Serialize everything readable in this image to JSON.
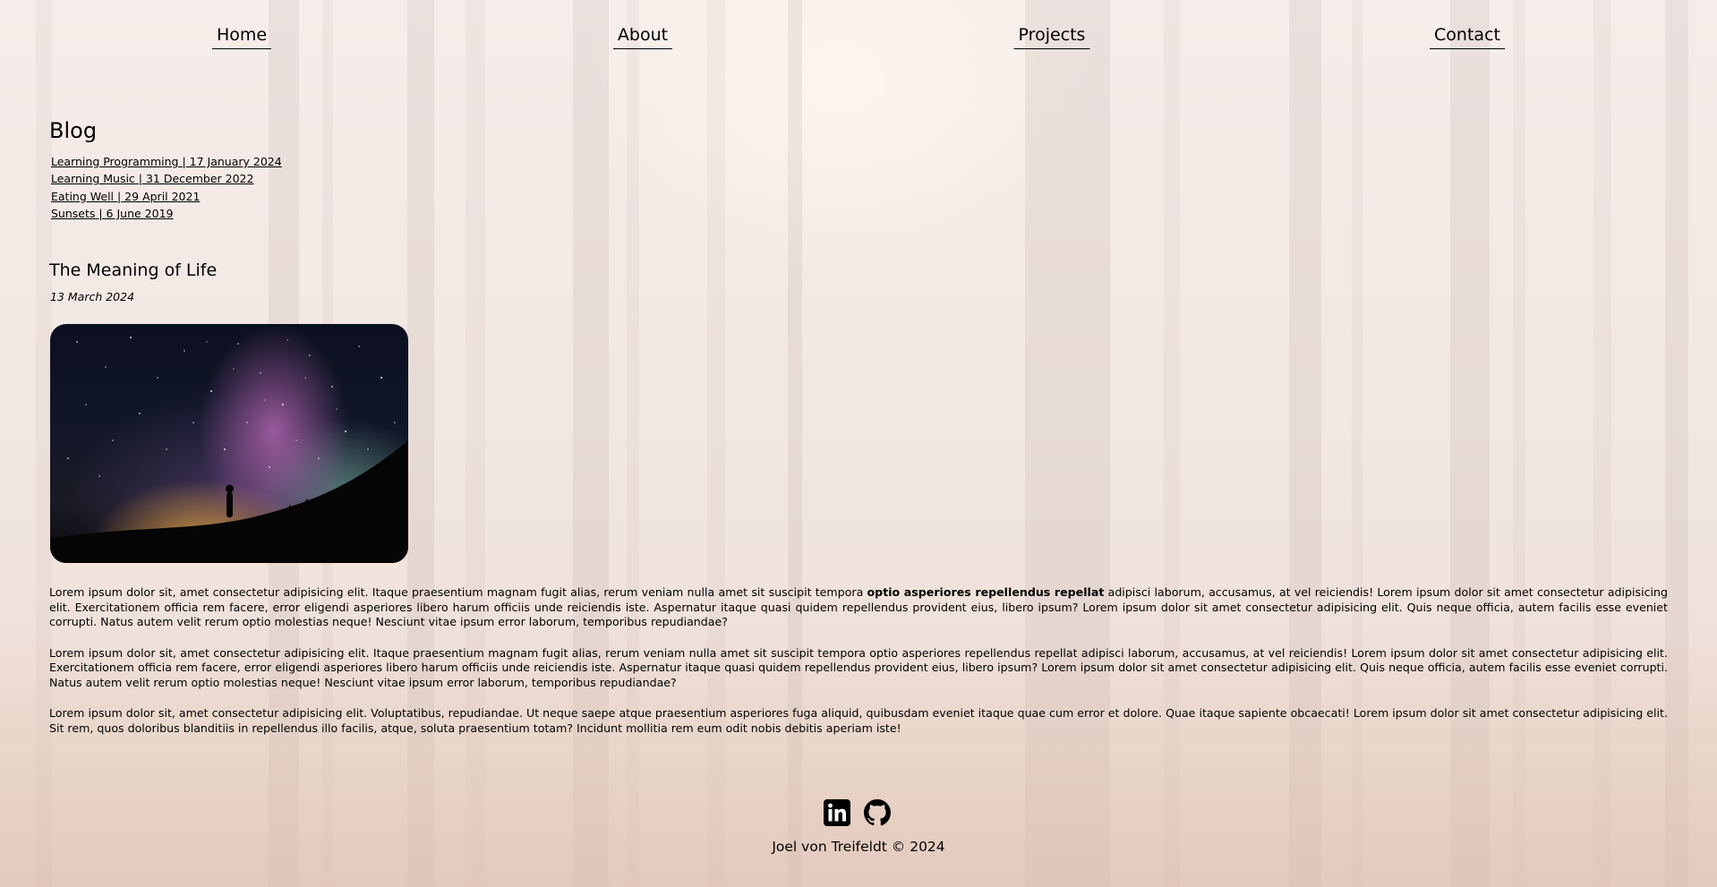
{
  "nav": {
    "items": [
      "Home",
      "About",
      "Projects",
      "Contact"
    ]
  },
  "blog": {
    "title": "Blog",
    "posts": [
      "Learning Programming | 17 January 2024",
      "Learning Music | 31 December 2022",
      "Eating Well | 29 April 2021",
      "Sunsets | 6 June 2019"
    ]
  },
  "article": {
    "title": "The Meaning of Life",
    "date": "13 March 2024",
    "image_icon": "milky-way-photo",
    "paragraphs": [
      {
        "before": "Lorem ipsum dolor sit, amet consectetur adipisicing elit. Itaque praesentium magnam fugit alias, rerum veniam nulla amet sit suscipit tempora ",
        "bold": "optio asperiores repellendus repellat",
        "after": " adipisci laborum, accusamus, at vel reiciendis! Lorem ipsum dolor sit amet consectetur adipisicing elit. Exercitationem officia rem facere, error eligendi asperiores libero harum officiis unde reiciendis iste. Aspernatur itaque quasi quidem repellendus provident eius, libero ipsum? Lorem ipsum dolor sit amet consectetur adipisicing elit. Quis neque officia, autem facilis esse eveniet corrupti. Natus autem velit rerum optio molestias neque! Nesciunt vitae ipsum error laborum, temporibus repudiandae?"
      },
      "Lorem ipsum dolor sit, amet consectetur adipisicing elit. Itaque praesentium magnam fugit alias, rerum veniam nulla amet sit suscipit tempora optio asperiores repellendus repellat adipisci laborum, accusamus, at vel reiciendis! Lorem ipsum dolor sit amet consectetur adipisicing elit. Exercitationem officia rem facere, error eligendi asperiores libero harum officiis unde reiciendis iste. Aspernatur itaque quasi quidem repellendus provident eius, libero ipsum? Lorem ipsum dolor sit amet consectetur adipisicing elit. Quis neque officia, autem facilis esse eveniet corrupti. Natus autem velit rerum optio molestias neque! Nesciunt vitae ipsum error laborum, temporibus repudiandae?",
      "Lorem ipsum dolor sit, amet consectetur adipisicing elit. Voluptatibus, repudiandae. Ut neque saepe atque praesentium asperiores fuga aliquid, quibusdam eveniet itaque quae cum error et dolore. Quae itaque sapiente obcaecati! Lorem ipsum dolor sit amet consectetur adipisicing elit. Sit rem, quos doloribus blanditiis in repellendus illo facilis, atque, soluta praesentium totam? Incidunt mollitia rem eum odit nobis debitis aperiam iste!"
    ]
  },
  "footer": {
    "social": [
      {
        "icon": "linkedin-icon"
      },
      {
        "icon": "github-icon"
      }
    ],
    "text": "Joel von Treifeldt © 2024"
  }
}
